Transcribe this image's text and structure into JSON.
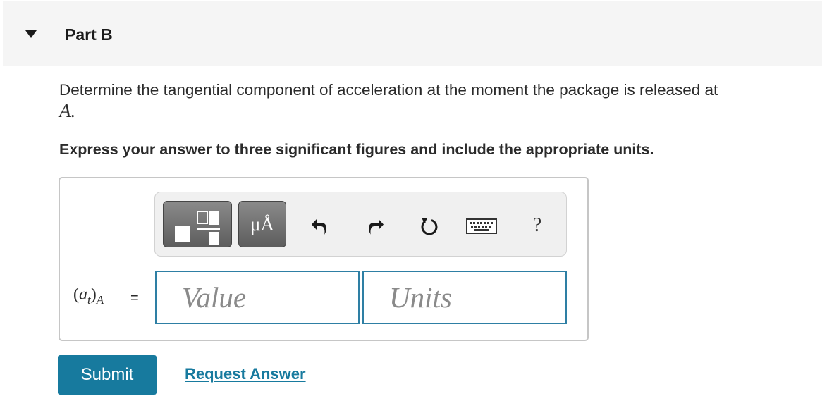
{
  "part": {
    "title": "Part B"
  },
  "question": {
    "text": "Determine the tangential component of acceleration at the moment the package is released at",
    "variable": "A."
  },
  "instruction": "Express your answer to three significant figures and include the appropriate units.",
  "toolbar": {
    "templates_icon": "fraction-template-icon",
    "units_label": "μÅ",
    "undo_icon": "undo-icon",
    "redo_icon": "redo-icon",
    "reset_icon": "reset-icon",
    "keyboard_icon": "keyboard-icon",
    "help_label": "?"
  },
  "answer": {
    "label_open": "(",
    "label_a": "a",
    "label_t": "t",
    "label_close": ")",
    "label_A": "A",
    "equals": "=",
    "value_placeholder": "Value",
    "units_placeholder": "Units"
  },
  "actions": {
    "submit_label": "Submit",
    "request_label": "Request Answer"
  },
  "colors": {
    "accent": "#177a9e",
    "field_border": "#2e7fa4",
    "header_bg": "#f5f5f5"
  }
}
